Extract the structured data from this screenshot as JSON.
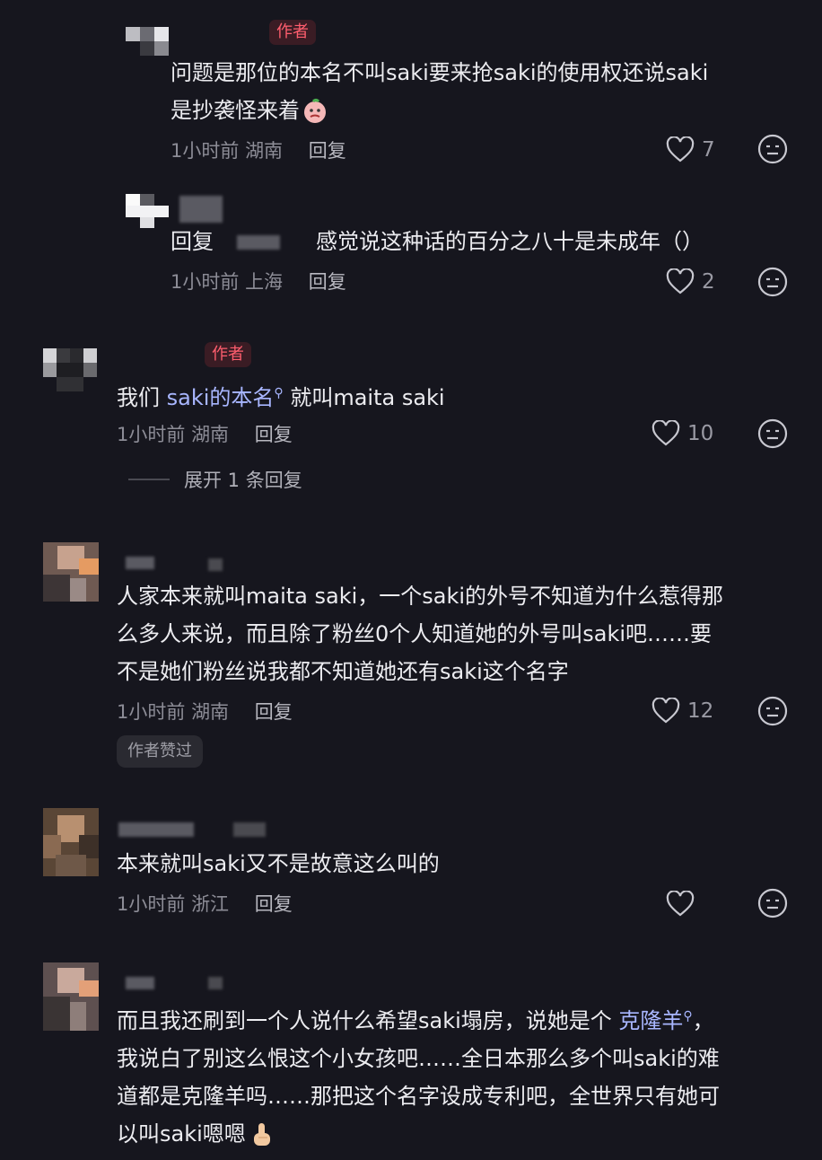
{
  "comments": [
    {
      "author_badge": "作者",
      "text_parts": [
        "问题是那位的本名不叫saki要来抢saki的使用权还说saki",
        "是抄袭怪来着"
      ],
      "time": "1小时前",
      "location": "湖南",
      "reply_label": "回复",
      "likes": "7",
      "emoji": "thinking-peach-emoji"
    },
    {
      "reply_prefix": "回复",
      "text": "感觉说这种话的百分之八十是未成年（）",
      "time": "1小时前",
      "location": "上海",
      "reply_label": "回复",
      "likes": "2"
    },
    {
      "author_badge": "作者",
      "text_before": "我们 ",
      "link_text": "saki的本名",
      "text_after": " 就叫maita saki",
      "time": "1小时前",
      "location": "湖南",
      "reply_label": "回复",
      "likes": "10",
      "expand_label": "展开 1 条回复"
    },
    {
      "lines": [
        "人家本来就叫maita saki，一个saki的外号不知道为什么惹得那",
        "么多人来说，而且除了粉丝0个人知道她的外号叫saki吧……要",
        "不是她们粉丝说我都不知道她还有saki这个名字"
      ],
      "time": "1小时前",
      "location": "湖南",
      "reply_label": "回复",
      "likes": "12",
      "praised_label": "作者赞过"
    },
    {
      "text": "本来就叫saki又不是故意这么叫的",
      "time": "1小时前",
      "location": "浙江",
      "reply_label": "回复",
      "likes": ""
    },
    {
      "line1_before": "而且我还刷到一个人说什么希望saki塌房，说她是个 ",
      "line1_link": "克隆羊",
      "line1_after": "，",
      "lines": [
        "我说白了别这么恨这个小女孩吧……全日本那么多个叫saki的难",
        "道都是克隆羊吗……那把这个名字设成专利吧，全世界只有她可"
      ],
      "last_line": "以叫saki嗯嗯",
      "emoji": "pointing-hand-emoji"
    }
  ],
  "icons": {
    "like": "heart-outline-icon",
    "dislike": "neutral-face-icon",
    "search": "search-icon"
  },
  "colors": {
    "background": "#16161e",
    "badge_text": "#ff5e6e",
    "link": "#a8b6ff",
    "meta": "#8c8c96"
  }
}
